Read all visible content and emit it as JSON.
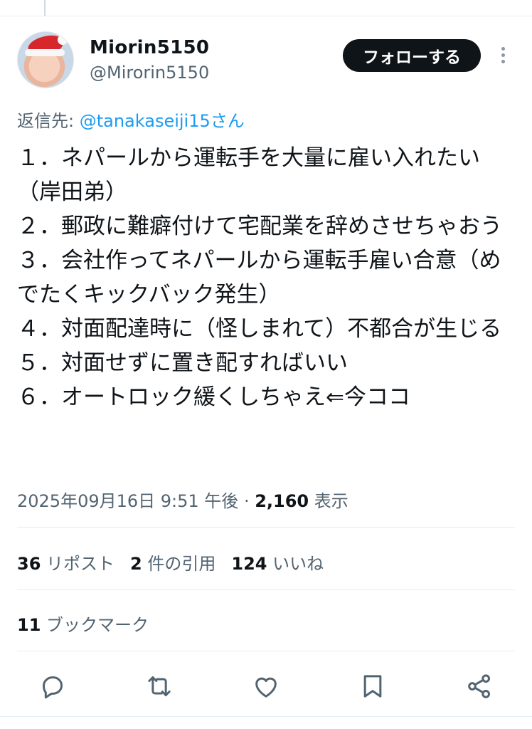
{
  "user": {
    "display_name": "Miorin5150",
    "handle": "@Mirorin5150",
    "avatar_icon": "avatar-santa-hat-baby"
  },
  "follow_button": "フォローする",
  "reply": {
    "prefix": "返信先: ",
    "mention": "@tanakaseiji15",
    "suffix": "さん"
  },
  "tweet_lines": [
    "１．ネパールから運転手を大量に雇い入れたい（岸田弟）",
    "２．郵政に難癖付けて宅配業を辞めさせちゃおう",
    "３．会社作ってネパールから運転手雇い合意（めでたくキックバック発生）",
    "４．対面配達時に（怪しまれて）不都合が生じる",
    "５．対面せずに置き配すればいい",
    "６．オートロック緩くしちゃえ⇐今ココ"
  ],
  "meta": {
    "timestamp": "2025年09月16日 9:51 午後",
    "separator": " · ",
    "views": "2,160",
    "views_label": " 表示"
  },
  "stats": {
    "reposts_count": "36",
    "reposts_label": "リポスト",
    "quotes_count": "2",
    "quotes_label": "件の引用",
    "likes_count": "124",
    "likes_label": "いいね",
    "bookmarks_count": "11",
    "bookmarks_label": "ブックマーク"
  },
  "actions": [
    "reply-icon",
    "repost-icon",
    "like-icon",
    "bookmark-icon",
    "share-icon"
  ],
  "colors": {
    "accent": "#1d9bf0",
    "text": "#0f1419",
    "secondary": "#536471",
    "icon": "#536471"
  }
}
